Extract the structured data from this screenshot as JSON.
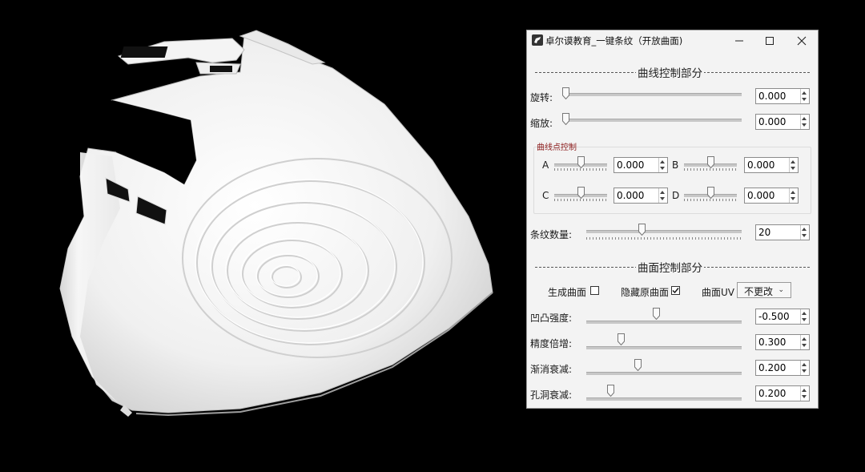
{
  "window": {
    "title": "卓尔谟教育_一键条纹（开放曲面)",
    "icon": "rhino-icon"
  },
  "curve_section": {
    "header": "曲线控制部分",
    "rotate": {
      "label": "旋转:",
      "value": "0.000",
      "slider_fraction": 0.0
    },
    "scale": {
      "label": "缩放:",
      "value": "0.000",
      "slider_fraction": 0.0
    },
    "points_group": {
      "title": "曲线点控制",
      "points": [
        {
          "label": "A",
          "value": "0.000",
          "slider_fraction": 0.5
        },
        {
          "label": "B",
          "value": "0.000",
          "slider_fraction": 0.5
        },
        {
          "label": "C",
          "value": "0.000",
          "slider_fraction": 0.5
        },
        {
          "label": "D",
          "value": "0.000",
          "slider_fraction": 0.5
        }
      ]
    },
    "stripe_count": {
      "label": "条纹数量:",
      "value": "20",
      "slider_fraction": 0.36
    }
  },
  "surface_section": {
    "header": "曲面控制部分",
    "generate_surface": {
      "label": "生成曲面",
      "checked": false
    },
    "hide_original": {
      "label": "隐藏原曲面",
      "checked": true
    },
    "surface_uv": {
      "label": "曲面UV",
      "selected": "不更改"
    },
    "bump": {
      "label": "凹凸强度:",
      "value": "-0.500",
      "slider_fraction": 0.45
    },
    "precision": {
      "label": "精度倍增:",
      "value": "0.300",
      "slider_fraction": 0.21
    },
    "fade": {
      "label": "渐消衰减:",
      "value": "0.200",
      "slider_fraction": 0.33
    },
    "hole_fade": {
      "label": "孔洞衰减:",
      "value": "0.200",
      "slider_fraction": 0.15
    }
  },
  "colors": {
    "accent_group_title": "#8b1a1a",
    "dialog_bg": "#f3f3f3",
    "viewport_bg": "#000000"
  }
}
